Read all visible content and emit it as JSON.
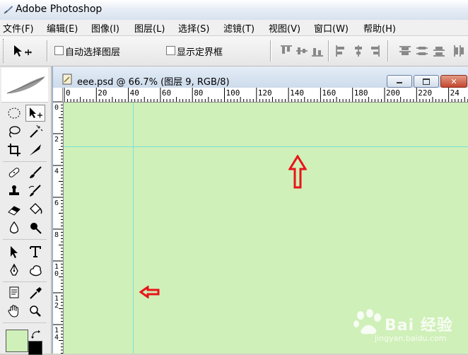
{
  "app": {
    "title": "Adobe Photoshop"
  },
  "menu": [
    "文件(F)",
    "编辑(E)",
    "图像(I)",
    "图层(L)",
    "选择(S)",
    "滤镜(T)",
    "视图(V)",
    "窗口(W)",
    "帮助(H)"
  ],
  "options": {
    "auto_select_label": "自动选择图层",
    "show_bounds_label": "显示定界框",
    "auto_select_checked": false,
    "show_bounds_checked": false
  },
  "document": {
    "title": "eee.psd @ 66.7% (图层 9, RGB/8)",
    "ruler_h": [
      "0",
      "20",
      "40",
      "60",
      "80",
      "100",
      "120",
      "140",
      "160",
      "180",
      "200",
      "220",
      "24"
    ],
    "ruler_v": [
      "0",
      "2",
      "4",
      "6",
      "8",
      "1 0",
      "1 2",
      "1 4"
    ],
    "canvas_color": "#cff0b8",
    "guide_color": "#7be0d8",
    "arrow_color": "#e8141c"
  },
  "swatches": {
    "foreground": "#cff0b8",
    "background": "#000000"
  },
  "watermark": {
    "text": "Bai 经验",
    "sub": "jingyan.baidu.com"
  }
}
